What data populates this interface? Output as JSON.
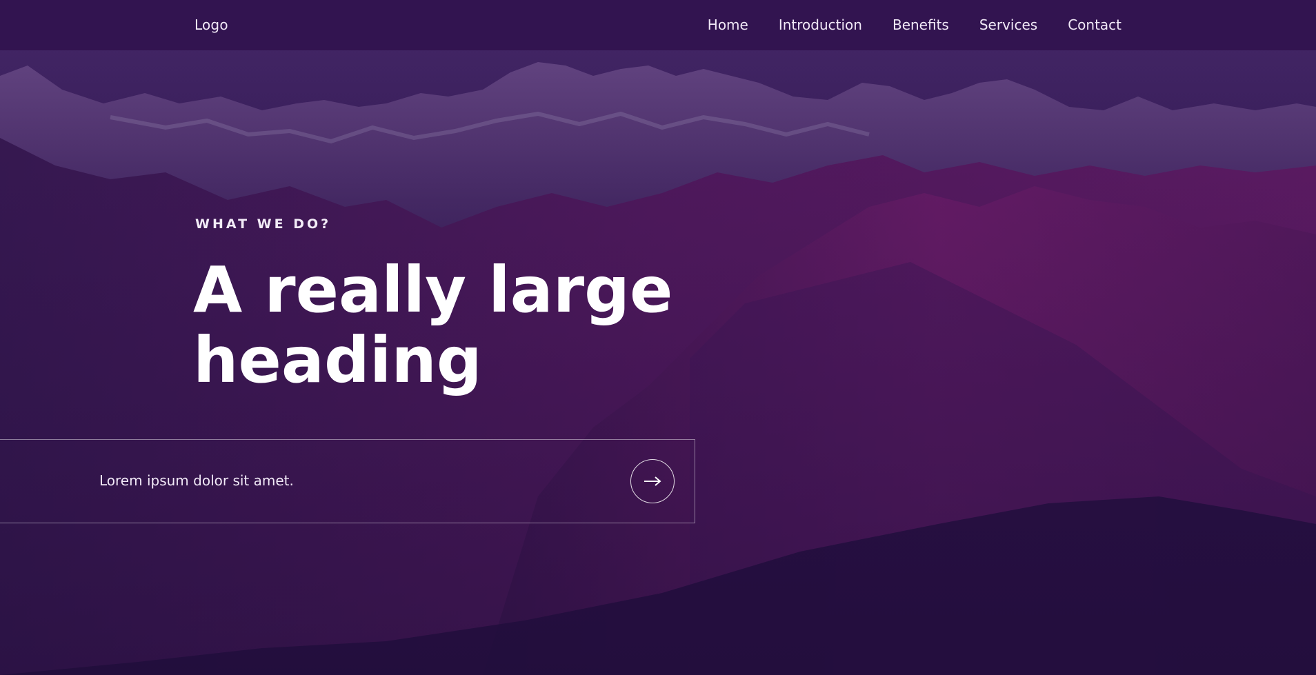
{
  "nav": {
    "logo": "Logo",
    "links": [
      {
        "label": "Home"
      },
      {
        "label": "Introduction"
      },
      {
        "label": "Benefits"
      },
      {
        "label": "Services"
      },
      {
        "label": "Contact"
      }
    ]
  },
  "hero": {
    "eyebrow": "WHAT WE DO?",
    "heading": "A really large heading",
    "cta_text": "Lorem ipsum dolor sit amet.",
    "cta_icon": "arrow-right-icon",
    "background_image": "purple-mountain-range"
  },
  "colors": {
    "navbar": "#321450",
    "overlay": "#2a1248",
    "text": "#ffffff"
  }
}
